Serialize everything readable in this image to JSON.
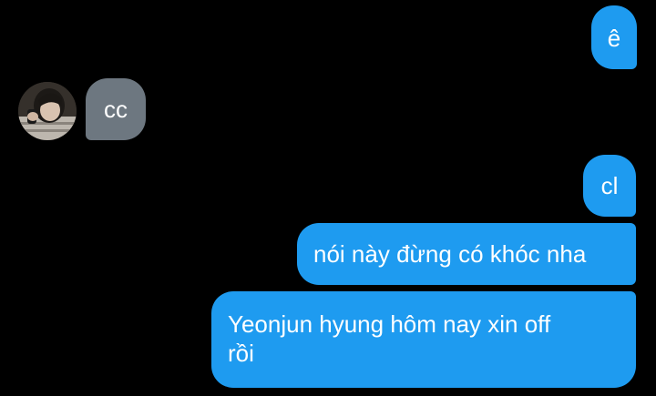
{
  "conversation": {
    "messages": [
      {
        "direction": "outgoing",
        "text": "ê"
      },
      {
        "direction": "incoming",
        "text": "cc"
      },
      {
        "direction": "outgoing",
        "text": "cl"
      },
      {
        "direction": "outgoing",
        "text": "nói này đừng có khóc nha"
      },
      {
        "direction": "outgoing",
        "lines": [
          "Yeonjun hyung hôm nay xin off",
          "rồi"
        ]
      }
    ]
  },
  "avatar": {
    "icon": "contact-avatar"
  },
  "colors": {
    "background": "#000000",
    "outgoing_bubble": "#1e9bf0",
    "incoming_bubble": "#6d7780",
    "text": "#ffffff"
  }
}
